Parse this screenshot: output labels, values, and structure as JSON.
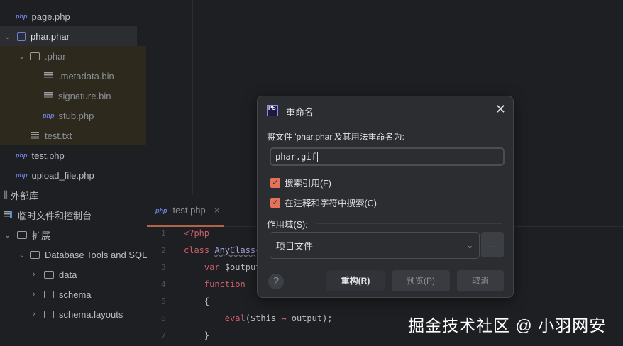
{
  "tree": [
    {
      "label": "page.php",
      "icon": "php"
    },
    {
      "label": "phar.phar",
      "icon": "phar",
      "chevron": "open"
    },
    {
      "label": ".phar",
      "icon": "folder",
      "chevron": "open"
    },
    {
      "label": ".metadata.bin",
      "icon": "text"
    },
    {
      "label": "signature.bin",
      "icon": "text"
    },
    {
      "label": "stub.php",
      "icon": "php"
    },
    {
      "label": "test.txt",
      "icon": "text"
    },
    {
      "label": "test.php",
      "icon": "php"
    },
    {
      "label": "upload_file.php",
      "icon": "php"
    },
    {
      "label": "外部库",
      "icon": "library"
    },
    {
      "label": "临时文件和控制台",
      "icon": "scratch"
    },
    {
      "label": "扩展",
      "icon": "folder",
      "chevron": "open"
    },
    {
      "label": "Database Tools and SQL",
      "icon": "folder",
      "chevron": "open"
    },
    {
      "label": "data",
      "icon": "folder",
      "chevron": "closed"
    },
    {
      "label": "schema",
      "icon": "folder",
      "chevron": "closed"
    },
    {
      "label": "schema.layouts",
      "icon": "folder",
      "chevron": "closed"
    }
  ],
  "php_badge": "php",
  "editor": {
    "tab": "test.php",
    "tab_close": "×",
    "line_numbers": [
      "1",
      "2",
      "3",
      "4",
      "5",
      "6",
      "7"
    ]
  },
  "dialog": {
    "logo": "PS",
    "title": "重命名",
    "close": "✕",
    "prompt": "将文件 'phar.phar'及其用法重命名为:",
    "new_name": "phar.gif",
    "check_refs": "搜索引用(F)",
    "check_comments": "在注释和字符中搜索(C)",
    "scope_label": "作用域(S):",
    "scope_value": "项目文件",
    "more": "...",
    "help": "?",
    "refactor": "重构(R)",
    "preview": "预览(P)",
    "cancel": "取消"
  },
  "watermark": "掘金技术社区 @ 小羽网安",
  "colors": {
    "accent": "#e5735a",
    "bg": "#1e1f22",
    "dialog": "#2b2d30"
  }
}
